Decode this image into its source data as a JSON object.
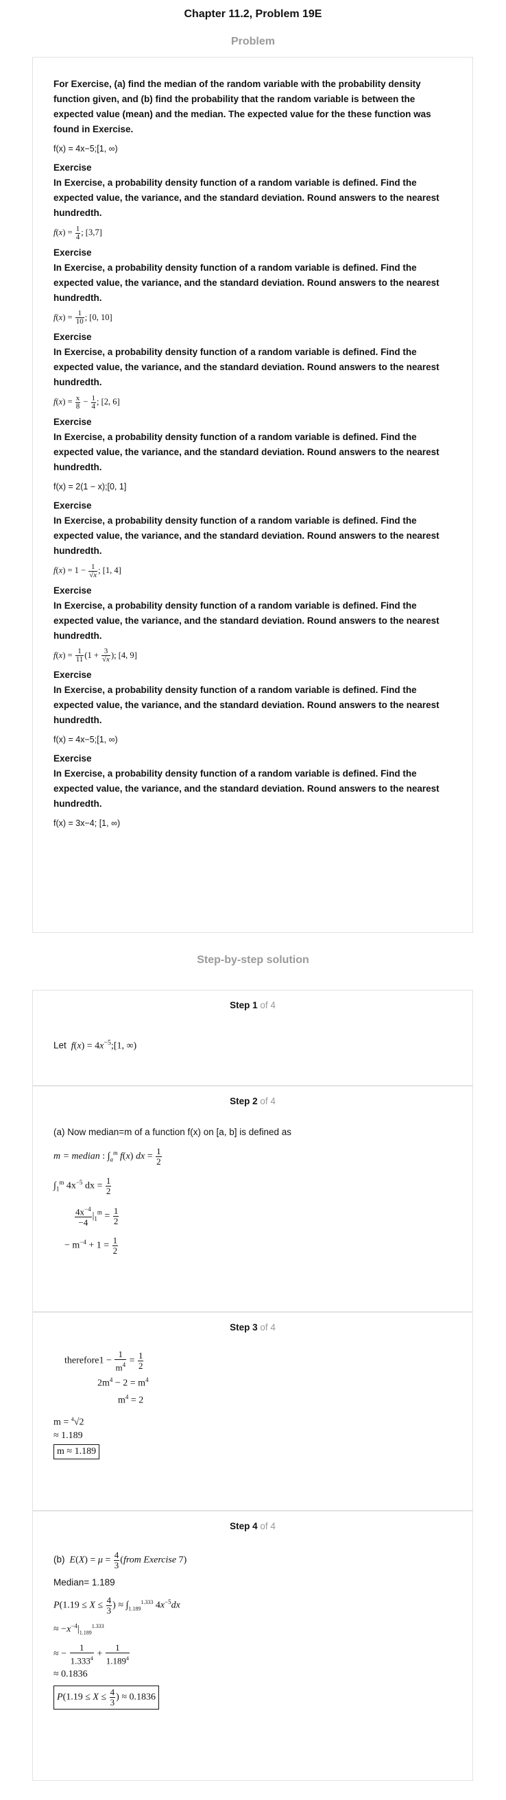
{
  "header": {
    "chapter_title": "Chapter 11.2, Problem 19E",
    "problem_label": "Problem",
    "solution_label": "Step-by-step solution"
  },
  "problem": {
    "intro": "For Exercise, (a) find the median of the random variable with the probability density function given, and (b) find the probability that the random variable is between the expected value (mean) and the median. The expected value for the these function was found in Exercise.",
    "main_fn": "f(x) = 4x−5;[1, ∞)",
    "exercise_label": "Exercise",
    "exercise_text": "In Exercise, a probability density function of a random variable is defined. Find the expected value, the variance, and the standard deviation. Round answers to the nearest hundredth.",
    "fn1": "; [3,7]",
    "fn2": "; [0, 10]",
    "fn3": "; [2, 6]",
    "fn4": "f(x) = 2(1 − x);[0, 1]",
    "fn5": "; [1, 4]",
    "fn6": "; [4, 9]",
    "fn7": "f(x) = 4x−5;[1, ∞)",
    "fn8": "f(x) = 3x−4; [1, ∞)"
  },
  "steps": {
    "of_label": "of 4",
    "step_label": "Step",
    "s1": {
      "num": "1",
      "let": "Let",
      "expr": "f(x) = 4x",
      "exp": "−5",
      "tail": ";[1, ∞)"
    },
    "s2": {
      "num": "2",
      "text": "(a) Now median=m of a function f(x) on [a, b] is defined as"
    },
    "s3": {
      "num": "3",
      "therefore": "therefore",
      "result": "m ≈ 1.189"
    },
    "s4": {
      "num": "4",
      "intro": "(b)",
      "median": "Median= 1.189",
      "approx": "≈ 0.1836",
      "result": "≈ 0.1836"
    }
  }
}
